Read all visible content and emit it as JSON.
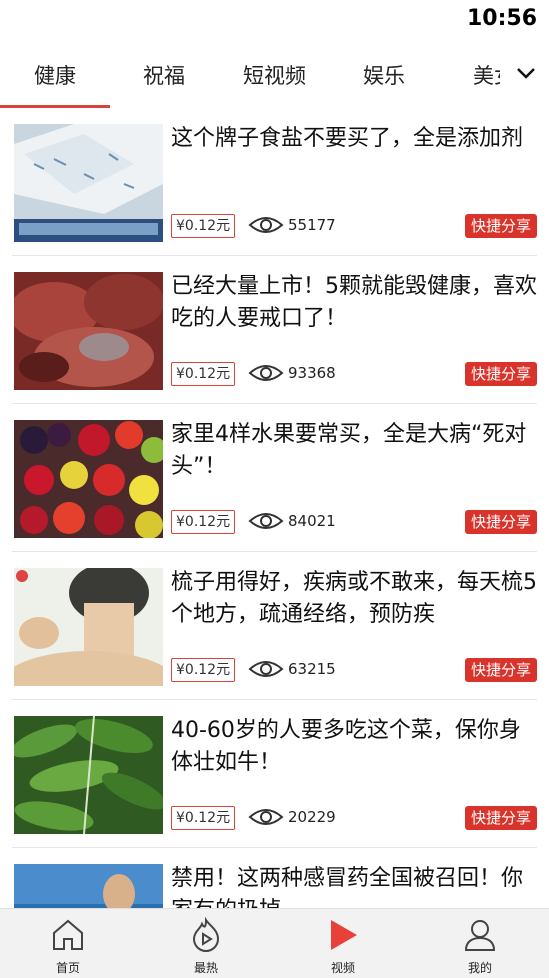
{
  "status": {
    "time": "10:56"
  },
  "tabs": [
    {
      "label": "健康",
      "active": true
    },
    {
      "label": "祝福"
    },
    {
      "label": "短视频"
    },
    {
      "label": "娱乐"
    },
    {
      "label": "美女"
    }
  ],
  "feed": [
    {
      "title": "这个牌子食盐不要买了，全是添加剂",
      "price": "¥0.12元",
      "views": "55177",
      "share": "快捷分享",
      "thumb": "salt-bags-photo"
    },
    {
      "title": "已经大量上市！5颗就能毁健康，喜欢吃的人要戒口了！",
      "price": "¥0.12元",
      "views": "93368",
      "share": "快捷分享",
      "thumb": "meat-photo"
    },
    {
      "title": "家里4样水果要常买，全是大病“死对头”！",
      "price": "¥0.12元",
      "views": "84021",
      "share": "快捷分享",
      "thumb": "fruits-photo"
    },
    {
      "title": "梳子用得好，疾病或不敢来，每天梳5个地方，疏通经络，预防疾",
      "price": "¥0.12元",
      "views": "63215",
      "share": "快捷分享",
      "thumb": "neck-photo"
    },
    {
      "title": "40-60岁的人要多吃这个菜，保你身体壮如牛！",
      "price": "¥0.12元",
      "views": "20229",
      "share": "快捷分享",
      "thumb": "green-leaves-photo"
    },
    {
      "title": "禁用！这两种感冒药全国被召回！你家有的扔掉",
      "price": "",
      "views": "",
      "share": "",
      "thumb": "news-anchor-photo"
    }
  ],
  "bottom_nav": [
    {
      "label": "首页",
      "icon": "home-icon"
    },
    {
      "label": "最热",
      "icon": "hot-icon"
    },
    {
      "label": "视频",
      "icon": "video-play-icon",
      "active": true
    },
    {
      "label": "我的",
      "icon": "user-icon"
    }
  ],
  "colors": {
    "accent": "#d9443a",
    "share_bg": "#d9342b",
    "nav_bg": "#f2f2f2"
  }
}
